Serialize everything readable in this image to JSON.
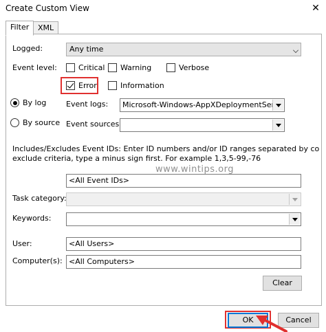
{
  "window": {
    "title": "Create Custom View",
    "close_glyph": "✕"
  },
  "tabs": [
    {
      "label": "Filter",
      "active": true
    },
    {
      "label": "XML",
      "active": false
    }
  ],
  "filter": {
    "logged_label": "Logged:",
    "logged_value": "Any time",
    "event_level_label": "Event level:",
    "levels": [
      {
        "label": "Critical",
        "checked": false
      },
      {
        "label": "Warning",
        "checked": false
      },
      {
        "label": "Verbose",
        "checked": false
      },
      {
        "label": "Error",
        "checked": true
      },
      {
        "label": "Information",
        "checked": false
      }
    ],
    "by_log_label": "By log",
    "by_source_label": "By source",
    "selected_option": "By log",
    "event_logs_label": "Event logs:",
    "event_logs_value": "Microsoft-Windows-AppXDeploymentServer/C",
    "event_sources_label": "Event sources:",
    "event_sources_value": "",
    "ids_help_line1": "Includes/Excludes Event IDs: Enter ID numbers and/or ID ranges separated by commas. To",
    "ids_help_line2": "exclude criteria, type a minus sign first. For example 1,3,5-99,-76",
    "event_ids_value": "<All Event IDs>",
    "task_category_label": "Task category:",
    "keywords_label": "Keywords:",
    "user_label": "User:",
    "user_value": "<All Users>",
    "computers_label": "Computer(s):",
    "computers_value": "<All Computers>",
    "clear_label": "Clear"
  },
  "footer": {
    "ok_label": "OK",
    "cancel_label": "Cancel"
  },
  "watermark": "www.wintips.org",
  "colors": {
    "highlight": "#e0302f",
    "default_button_border": "#0078d7"
  }
}
